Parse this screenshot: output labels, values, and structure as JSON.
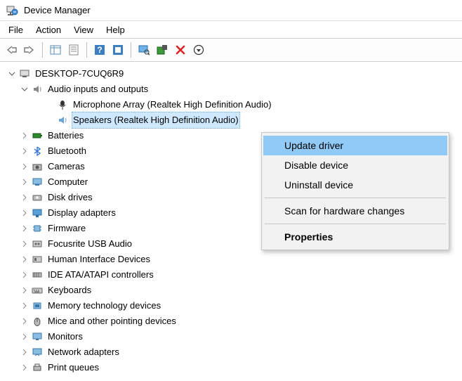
{
  "window_title": "Device Manager",
  "menu": {
    "file": "File",
    "action": "Action",
    "view": "View",
    "help": "Help"
  },
  "root": "DESKTOP-7CUQ6R9",
  "audio_category": "Audio inputs and outputs",
  "audio_mic": "Microphone Array (Realtek High Definition Audio)",
  "audio_speakers": "Speakers (Realtek High Definition Audio)",
  "cat": {
    "batteries": "Batteries",
    "bluetooth": "Bluetooth",
    "cameras": "Cameras",
    "computer": "Computer",
    "disk": "Disk drives",
    "display": "Display adapters",
    "firmware": "Firmware",
    "focusrite": "Focusrite USB Audio",
    "hid": "Human Interface Devices",
    "ide": "IDE ATA/ATAPI controllers",
    "keyboards": "Keyboards",
    "memory": "Memory technology devices",
    "mice": "Mice and other pointing devices",
    "monitors": "Monitors",
    "network": "Network adapters",
    "print": "Print queues"
  },
  "ctx": {
    "update": "Update driver",
    "disable": "Disable device",
    "uninstall": "Uninstall device",
    "scan": "Scan for hardware changes",
    "properties": "Properties"
  }
}
